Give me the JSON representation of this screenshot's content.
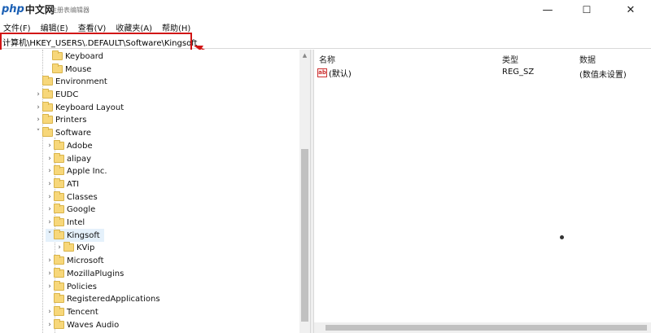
{
  "window": {
    "logo_php": "php",
    "logo_cn": "中文网",
    "title": "注册表编辑器",
    "minimize": "—",
    "maximize": "☐",
    "close": "✕"
  },
  "menu": [
    "文件(F)",
    "编辑(E)",
    "查看(V)",
    "收藏夹(A)",
    "帮助(H)"
  ],
  "address": "计算机\\HKEY_USERS\\.DEFAULT\\Software\\Kingsoft",
  "accent": "#d11515",
  "tree": [
    {
      "label": "Keyboard",
      "chev": "",
      "depth": 2,
      "selected": false
    },
    {
      "label": "Mouse",
      "chev": "",
      "depth": 2,
      "selected": false
    },
    {
      "label": "Environment",
      "chev": "",
      "depth": 1,
      "selected": false
    },
    {
      "label": "EUDC",
      "chev": "›",
      "depth": 1,
      "selected": false
    },
    {
      "label": "Keyboard Layout",
      "chev": "›",
      "depth": 1,
      "selected": false
    },
    {
      "label": "Printers",
      "chev": "›",
      "depth": 1,
      "selected": false
    },
    {
      "label": "Software",
      "chev": "˅",
      "depth": 1,
      "selected": false
    },
    {
      "label": "Adobe",
      "chev": "›",
      "depth": 2,
      "selected": false
    },
    {
      "label": "alipay",
      "chev": "›",
      "depth": 2,
      "selected": false
    },
    {
      "label": "Apple Inc.",
      "chev": "›",
      "depth": 2,
      "selected": false
    },
    {
      "label": "ATI",
      "chev": "›",
      "depth": 2,
      "selected": false
    },
    {
      "label": "Classes",
      "chev": "›",
      "depth": 2,
      "selected": false
    },
    {
      "label": "Google",
      "chev": "›",
      "depth": 2,
      "selected": false
    },
    {
      "label": "Intel",
      "chev": "›",
      "depth": 2,
      "selected": false
    },
    {
      "label": "Kingsoft",
      "chev": "˅",
      "depth": 2,
      "selected": true
    },
    {
      "label": "KVip",
      "chev": "›",
      "depth": 3,
      "selected": false
    },
    {
      "label": "Microsoft",
      "chev": "›",
      "depth": 2,
      "selected": false
    },
    {
      "label": "MozillaPlugins",
      "chev": "›",
      "depth": 2,
      "selected": false
    },
    {
      "label": "Policies",
      "chev": "›",
      "depth": 2,
      "selected": false
    },
    {
      "label": "RegisteredApplications",
      "chev": "",
      "depth": 2,
      "selected": false
    },
    {
      "label": "Tencent",
      "chev": "›",
      "depth": 2,
      "selected": false
    },
    {
      "label": "Waves Audio",
      "chev": "›",
      "depth": 2,
      "selected": false
    }
  ],
  "columns": {
    "name": "名称",
    "type": "类型",
    "data": "数据"
  },
  "values": [
    {
      "icon": "ab",
      "name": "(默认)",
      "type": "REG_SZ",
      "data": "(数值未设置)"
    }
  ]
}
